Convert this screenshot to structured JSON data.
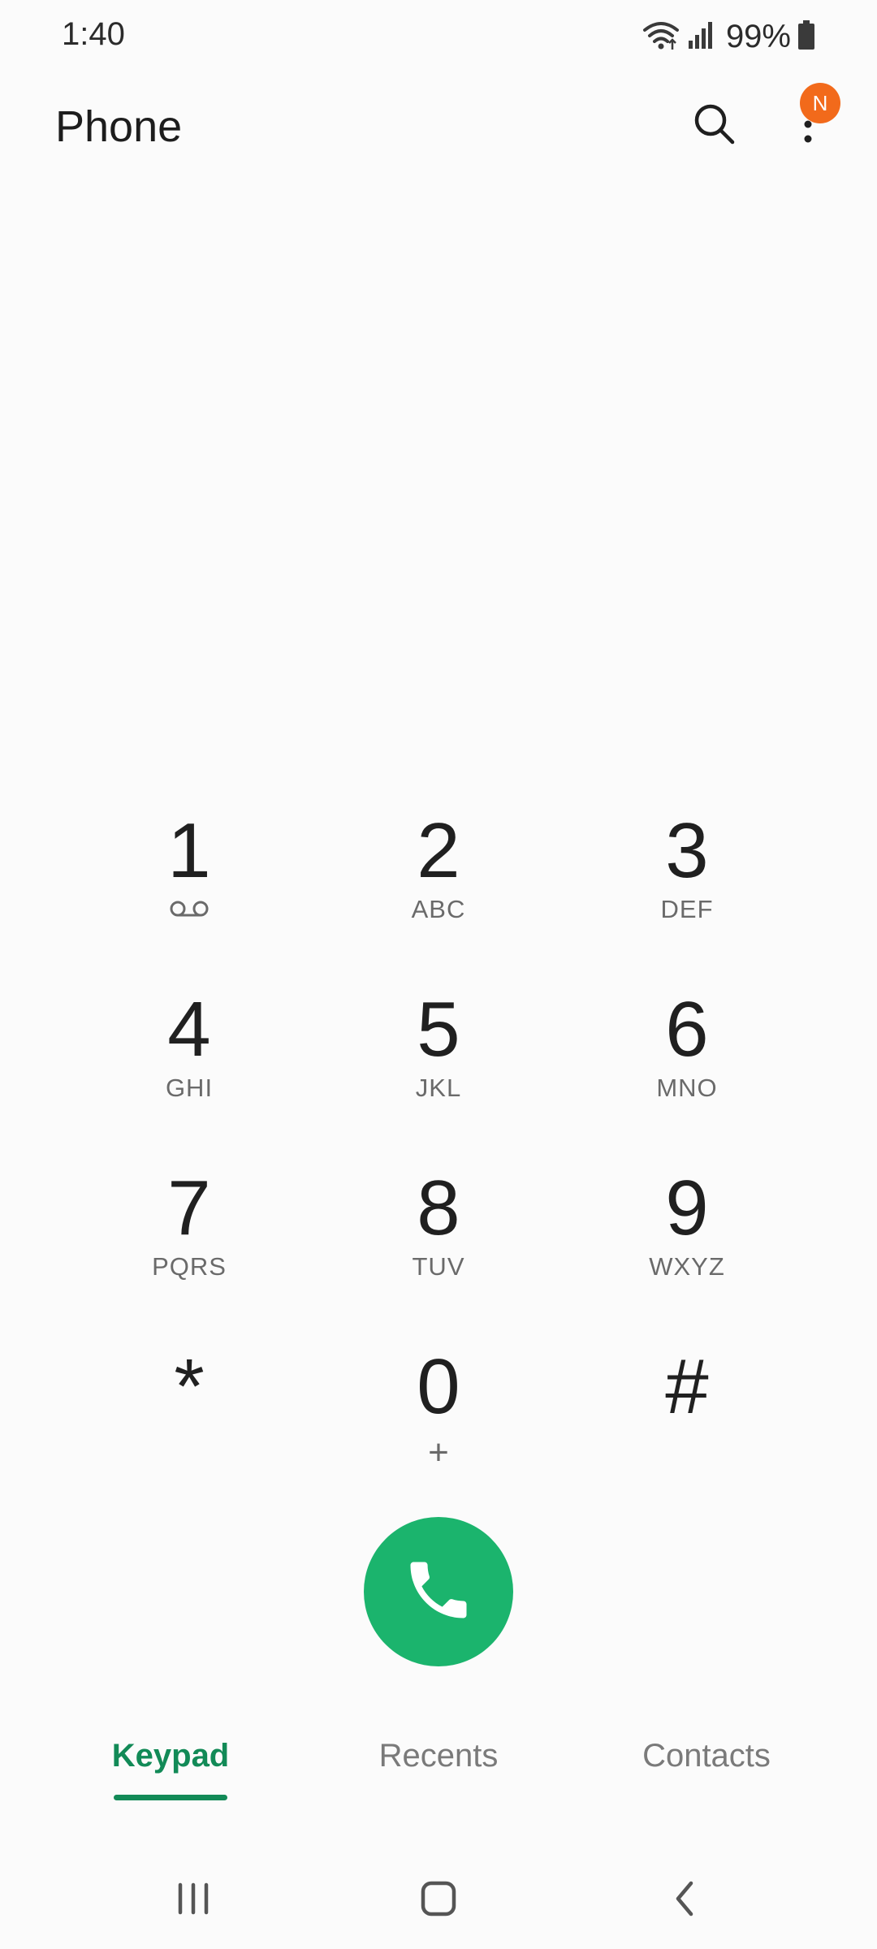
{
  "status_bar": {
    "time": "1:40",
    "battery_percent": "99%",
    "icons": [
      "wifi-icon",
      "signal-icon",
      "battery-icon"
    ]
  },
  "header": {
    "title": "Phone",
    "search_icon": "search-icon",
    "more_icon": "more-vert-icon",
    "badge": "N"
  },
  "keypad": {
    "keys": [
      {
        "digit": "1",
        "letters": "",
        "sub_icon": "voicemail-icon"
      },
      {
        "digit": "2",
        "letters": "ABC"
      },
      {
        "digit": "3",
        "letters": "DEF"
      },
      {
        "digit": "4",
        "letters": "GHI"
      },
      {
        "digit": "5",
        "letters": "JKL"
      },
      {
        "digit": "6",
        "letters": "MNO"
      },
      {
        "digit": "7",
        "letters": "PQRS"
      },
      {
        "digit": "8",
        "letters": "TUV"
      },
      {
        "digit": "9",
        "letters": "WXYZ"
      },
      {
        "digit": "*",
        "letters": ""
      },
      {
        "digit": "0",
        "letters": "+"
      },
      {
        "digit": "#",
        "letters": ""
      }
    ]
  },
  "call_button": {
    "icon": "phone-icon"
  },
  "tabs": [
    {
      "label": "Keypad",
      "active": true
    },
    {
      "label": "Recents",
      "active": false
    },
    {
      "label": "Contacts",
      "active": false
    }
  ],
  "colors": {
    "accent": "#128a57",
    "call_green": "#1bb46d",
    "badge_orange": "#f26a1b",
    "background": "#fbfbfb"
  },
  "navbar": {
    "icons": [
      "recent-apps-icon",
      "home-icon",
      "back-icon"
    ]
  }
}
